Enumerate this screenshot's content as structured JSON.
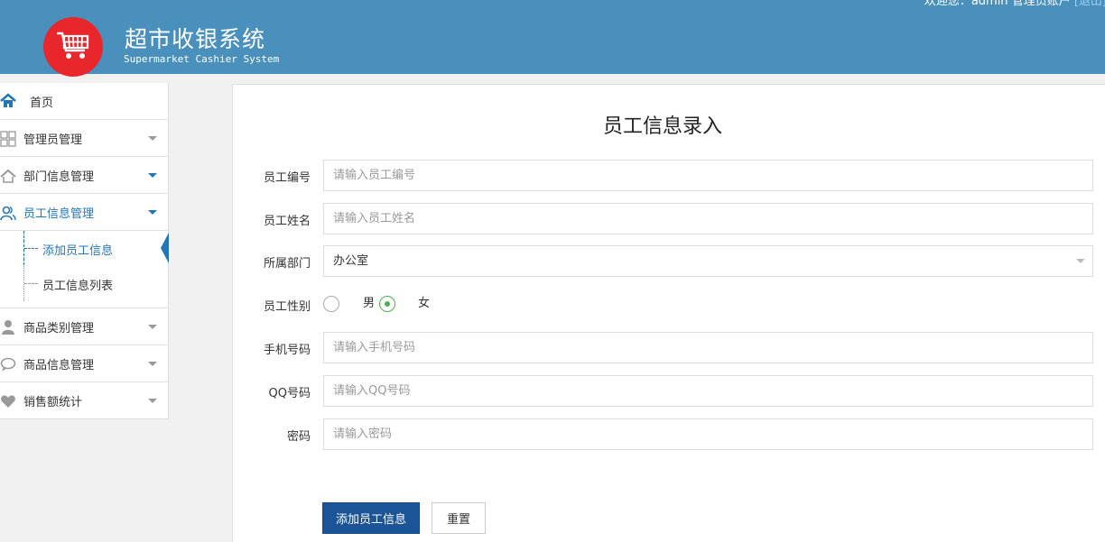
{
  "header": {
    "title_cn": "超市收银系统",
    "title_en": "Supermarket Cashier System",
    "welcome": "欢迎您：admin",
    "account_link": "管理员账户",
    "logout_link": "[退出]",
    "bg_color": "#4a90bd",
    "logo_color": "#e8262c",
    "logo_icon": "shopping-cart-icon"
  },
  "sidebar": {
    "items": [
      {
        "label": "首页",
        "icon": "home-icon"
      },
      {
        "label": "管理员管理",
        "icon": "grid-icon"
      },
      {
        "label": "部门信息管理",
        "icon": "house-icon"
      },
      {
        "label": "员工信息管理",
        "icon": "users-icon"
      },
      {
        "label": "商品类别管理",
        "icon": "person-icon"
      },
      {
        "label": "商品信息管理",
        "icon": "chat-icon"
      },
      {
        "label": "销售额统计",
        "icon": "heart-icon"
      }
    ],
    "submenu": [
      {
        "label": "添加员工信息"
      },
      {
        "label": "员工信息列表"
      }
    ],
    "accent_color": "#2475b8"
  },
  "form": {
    "title": "员工信息录入",
    "fields": {
      "emp_no": {
        "label": "员工编号",
        "placeholder": "请输入员工编号"
      },
      "emp_name": {
        "label": "员工姓名",
        "placeholder": "请输入员工姓名"
      },
      "department": {
        "label": "所属部门",
        "value": "办公室"
      },
      "gender": {
        "label": "员工性别",
        "options": [
          "男",
          "女"
        ],
        "selected": "女"
      },
      "phone": {
        "label": "手机号码",
        "placeholder": "请输入手机号码"
      },
      "qq": {
        "label": "QQ号码",
        "placeholder": "请输入QQ号码"
      },
      "password": {
        "label": "密码",
        "placeholder": "请输入密码"
      }
    },
    "submit_label": "添加员工信息",
    "reset_label": "重置",
    "primary_color": "#1b5598",
    "radio_color": "#4caf50"
  }
}
